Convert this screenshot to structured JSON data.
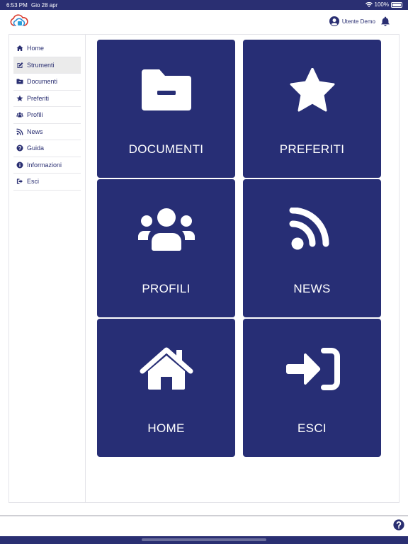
{
  "status": {
    "time": "6:53 PM",
    "date": "Gio 28 apr",
    "battery": "100%",
    "battery_level": 1.0
  },
  "header": {
    "user_name": "Utente Demo",
    "logo_icon": "cloud-logo-icon",
    "user_icon": "user-circle-icon",
    "bell_icon": "bell-icon"
  },
  "sidebar": {
    "items": [
      {
        "label": "Home",
        "icon": "home-icon",
        "active": false
      },
      {
        "label": "Strumenti",
        "icon": "edit-icon",
        "active": true
      },
      {
        "label": "Documenti",
        "icon": "folder-icon",
        "active": false
      },
      {
        "label": "Preferiti",
        "icon": "star-icon",
        "active": false
      },
      {
        "label": "Profili",
        "icon": "users-icon",
        "active": false
      },
      {
        "label": "News",
        "icon": "rss-icon",
        "active": false
      },
      {
        "label": "Guida",
        "icon": "question-circle-icon",
        "active": false
      },
      {
        "label": "Informazioni",
        "icon": "info-circle-icon",
        "active": false
      },
      {
        "label": "Esci",
        "icon": "sign-out-icon",
        "active": false
      }
    ]
  },
  "tiles": [
    {
      "label": "DOCUMENTI",
      "icon": "folder-minus-icon"
    },
    {
      "label": "PREFERITI",
      "icon": "star-icon"
    },
    {
      "label": "PROFILI",
      "icon": "users-icon"
    },
    {
      "label": "NEWS",
      "icon": "rss-icon"
    },
    {
      "label": "HOME",
      "icon": "home-icon"
    },
    {
      "label": "ESCI",
      "icon": "sign-in-icon"
    }
  ],
  "footer": {
    "help_icon": "question-circle-icon"
  },
  "colors": {
    "primary": "#272e75",
    "sidebar_active": "#ebebeb",
    "text": "#2a2f72"
  }
}
